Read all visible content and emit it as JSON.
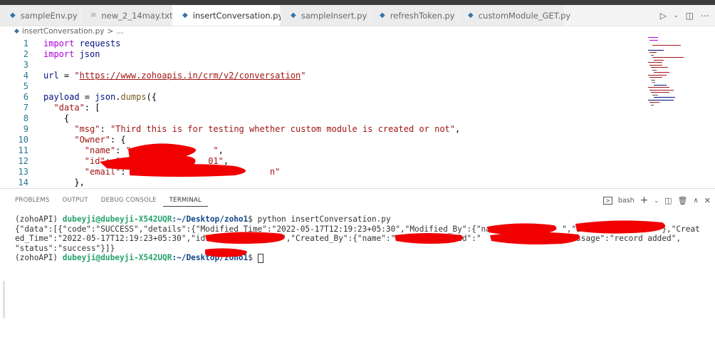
{
  "tabs": [
    {
      "label": "sampleEnv.py",
      "icon": "python-file-icon"
    },
    {
      "label": "new_2_14may.txt",
      "icon": "text-file-icon"
    },
    {
      "label": "insertConversation.py",
      "icon": "python-file-icon",
      "active": true
    },
    {
      "label": "sampleInsert.py",
      "icon": "python-file-icon"
    },
    {
      "label": "refreshToken.py",
      "icon": "python-file-icon"
    },
    {
      "label": "customModule_GET.py",
      "icon": "python-file-icon"
    }
  ],
  "breadcrumb": {
    "file": "insertConversation.py",
    "sep": ">",
    "more": "..."
  },
  "code_lines": [
    {
      "n": "1",
      "tokens": [
        [
          "kw",
          "import"
        ],
        [
          "var",
          " requests"
        ]
      ]
    },
    {
      "n": "2",
      "tokens": [
        [
          "kw",
          "import"
        ],
        [
          "var",
          " json"
        ]
      ]
    },
    {
      "n": "3",
      "tokens": []
    },
    {
      "n": "4",
      "tokens": [
        [
          "var",
          "url"
        ],
        [
          "pun",
          " = "
        ],
        [
          "str",
          "\""
        ],
        [
          "url",
          "https://www.zohoapis.in/crm/v2/conversation"
        ],
        [
          "str",
          "\""
        ]
      ]
    },
    {
      "n": "5",
      "tokens": []
    },
    {
      "n": "6",
      "tokens": [
        [
          "var",
          "payload"
        ],
        [
          "pun",
          " = "
        ],
        [
          "var",
          "json"
        ],
        [
          "pun",
          "."
        ],
        [
          "fn",
          "dumps"
        ],
        [
          "pun",
          "({"
        ]
      ]
    },
    {
      "n": "7",
      "tokens": [
        [
          "str",
          "  \"data\""
        ],
        [
          "pun",
          ": ["
        ]
      ]
    },
    {
      "n": "8",
      "tokens": [
        [
          "pun",
          "    {"
        ]
      ]
    },
    {
      "n": "9",
      "tokens": [
        [
          "str",
          "      \"msg\""
        ],
        [
          "pun",
          ": "
        ],
        [
          "str",
          "\"Third this is for testing whether custom module is created or not\""
        ],
        [
          "pun",
          ","
        ]
      ]
    },
    {
      "n": "10",
      "tokens": [
        [
          "str",
          "      \"Owner\""
        ],
        [
          "pun",
          ": {"
        ]
      ]
    },
    {
      "n": "11",
      "tokens": [
        [
          "str",
          "        \"name\""
        ],
        [
          "pun",
          ": "
        ],
        [
          "str",
          "\"                \""
        ],
        [
          "pun",
          ","
        ]
      ]
    },
    {
      "n": "12",
      "tokens": [
        [
          "str",
          "        \"id\""
        ],
        [
          "pun",
          ": "
        ],
        [
          "str",
          "\"                 01\""
        ],
        [
          "pun",
          ","
        ]
      ]
    },
    {
      "n": "13",
      "tokens": [
        [
          "str",
          "        \"email\""
        ],
        [
          "pun",
          ": "
        ],
        [
          "str",
          "\"                          n\""
        ]
      ]
    },
    {
      "n": "14",
      "tokens": [
        [
          "pun",
          "      },"
        ]
      ]
    }
  ],
  "panel_tabs": [
    "PROBLEMS",
    "OUTPUT",
    "DEBUG CONSOLE",
    "TERMINAL"
  ],
  "panel_shell": "bash",
  "terminal": {
    "env": "(zohoAPI) ",
    "user": "dubeyji@dubeyji-X542UQR",
    "path": ":~/Desktop/zoho1",
    "prompt_end": "$ ",
    "command": "python insertConversation.py",
    "out1": "{\"data\":[{\"code\":\"SUCCESS\",\"details\":{\"Modified_Time\":\"2022-05-17T12:19:23+05:30\",\"Modified_By\":{\"name\":\"          \",\"id\":\"            \"},\"Creat",
    "out2": "ed_Time\":\"2022-05-17T12:19:23+05:30\",\"id\":\"            0\",\"Created_By\":{\"name\":\"          \",\"id\":\"            1\"}},\"message\":\"record added\",",
    "out3": "\"status\":\"success\"}]}"
  },
  "colors": {
    "redaction": "#f00000",
    "terminal_green": "#26a269",
    "terminal_blue": "#12488b",
    "line_number": "#237893"
  }
}
